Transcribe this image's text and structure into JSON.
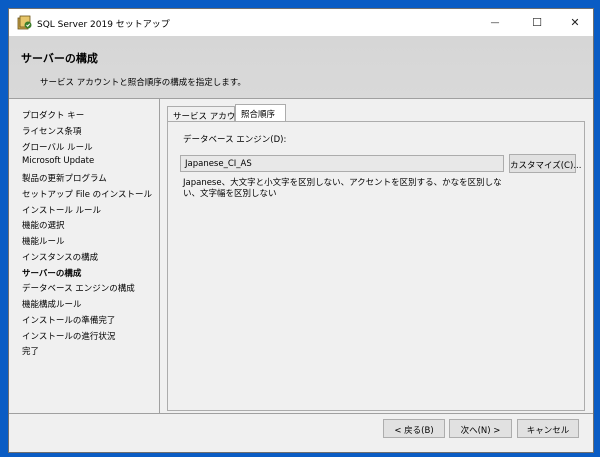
{
  "window": {
    "title": "SQL Server 2019 セットアップ",
    "min_glyph": "—",
    "max_glyph": "☐",
    "close_glyph": "✕"
  },
  "header": {
    "title": "サーバーの構成",
    "subtitle": "サービス アカウントと照合順序の構成を指定します。"
  },
  "steps": [
    {
      "label": "プロダクト キー"
    },
    {
      "label": "ライセンス条項"
    },
    {
      "label": "グローバル ルール"
    },
    {
      "label": "Microsoft Update"
    },
    {
      "label": "製品の更新プログラム"
    },
    {
      "label": "セットアップ File のインストール"
    },
    {
      "label": "インストール ルール"
    },
    {
      "label": "機能の選択"
    },
    {
      "label": "機能ルール"
    },
    {
      "label": "インスタンスの構成"
    },
    {
      "label": "サーバーの構成"
    },
    {
      "label": "データベース エンジンの構成"
    },
    {
      "label": "機能構成ルール"
    },
    {
      "label": "インストールの準備完了"
    },
    {
      "label": "インストールの進行状況"
    },
    {
      "label": "完了"
    }
  ],
  "active_step_index": 10,
  "tabs": [
    {
      "label": "サービス アカウント"
    },
    {
      "label": "照合順序"
    }
  ],
  "collation": {
    "label": "データベース エンジン(D):",
    "value": "Japanese_CI_AS",
    "customize_label": "カスタマイズ(C)...",
    "description": "Japanese、大文字と小文字を区別しない、アクセントを区別する、かなを区別しない、文字幅を区別しない"
  },
  "footer": {
    "back_label": "< 戻る(B)",
    "next_label": "次へ(N) >",
    "cancel_label": "キャンセル"
  }
}
